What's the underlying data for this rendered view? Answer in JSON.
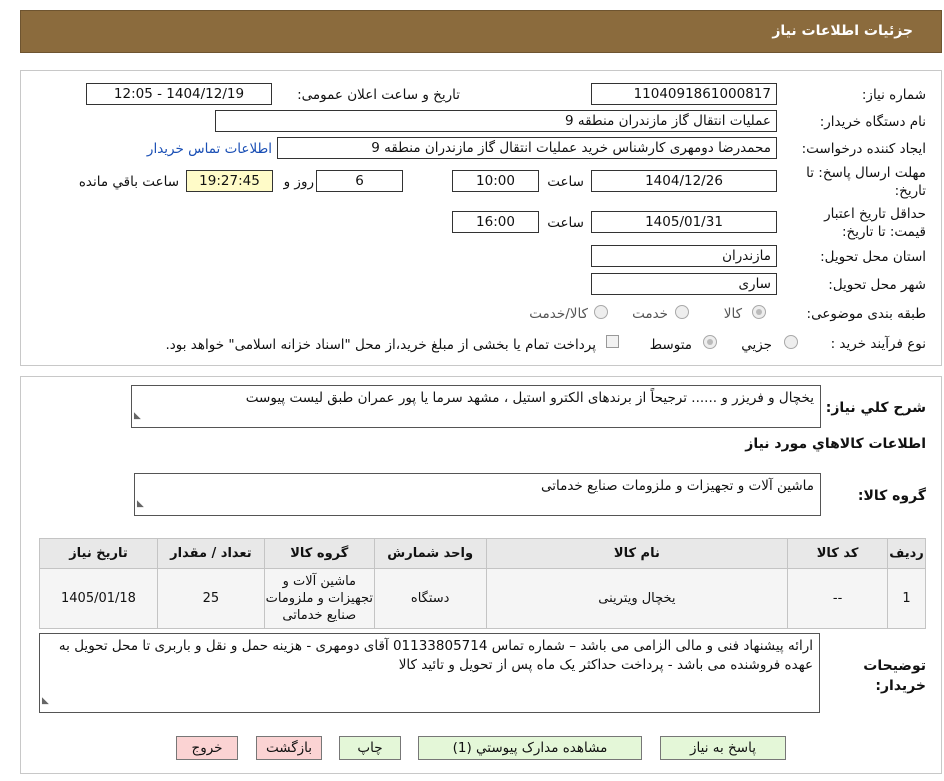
{
  "header": {
    "title": "جزئیات اطلاعات نیاز"
  },
  "form": {
    "need_number_label": "شماره نیاز:",
    "need_number": "1104091861000817",
    "announce_label": "تاریخ و ساعت اعلان عمومی:",
    "announce_value": "1404/12/19 - 12:05",
    "buyer_org_label": "نام دستگاه خریدار:",
    "buyer_org": "عملیات انتقال گاز مازندران منطقه 9",
    "requester_label": "ایجاد کننده درخواست:",
    "requester": "محمدرضا دومهری کارشناس خرید عملیات انتقال گاز مازندران منطقه 9",
    "contact_link": "اطلاعات تماس خریدار",
    "deadline_label": "مهلت ارسال پاسخ: تا تاریخ:",
    "deadline_date": "1404/12/26",
    "time_label": "ساعت",
    "deadline_time": "10:00",
    "days_value": "6",
    "days_label": "روز و",
    "remaining_time": "19:27:45",
    "remaining_label": "ساعت باقي مانده",
    "validity_label": "حداقل تاریخ اعتبار قیمت: تا تاریخ:",
    "validity_date": "1405/01/31",
    "validity_time": "16:00",
    "province_label": "استان محل تحویل:",
    "province": "مازندران",
    "city_label": "شهر محل تحویل:",
    "city": "ساری",
    "category_label": "طبقه بندی موضوعی:",
    "category_options": [
      "کالا",
      "خدمت",
      "کالا/خدمت"
    ],
    "process_label": "نوع فرآیند خرید :",
    "process_options": [
      "جزیي",
      "متوسط"
    ],
    "payment_note": "پرداخت تمام یا بخشی از مبلغ خرید،از محل \"اسناد خزانه اسلامی\" خواهد بود."
  },
  "description": {
    "label": "شرح كلي نياز:",
    "text": "یخچال و فریزر و ...... ترجیحاً از برندهای الکترو استیل ، مشهد سرما یا پور عمران طبق لیست پیوست"
  },
  "goods": {
    "section_title": "اطلاعات كالاهاي مورد نياز",
    "group_label": "گروه کالا:",
    "group_value": "ماشین آلات و تجهیزات و ملزومات صنایع خدماتی",
    "columns": [
      "رديف",
      "کد کالا",
      "نام کالا",
      "واحد شمارش",
      "گروه کالا",
      "تعداد / مقدار",
      "تاريخ نياز"
    ],
    "rows": [
      [
        "1",
        "--",
        "یخچال ویترینی",
        "دستگاه",
        "ماشین آلات و تجهیزات و ملزومات صنایع خدماتی",
        "25",
        "1405/01/18"
      ]
    ]
  },
  "buyer_notes": {
    "label": "توضيحات خريدار:",
    "text": "ارائه پیشنهاد فنی  و مالی الزامی می باشد – شماره تماس 01133805714 آقای دومهری  - هزینه حمل و نقل و باربری تا محل تحویل به عهده فروشنده می باشد - پرداخت حداکثر یک ماه پس از تحویل و تائید کالا"
  },
  "buttons": {
    "reply": "پاسخ به نياز",
    "attachments": "مشاهده مدارک پيوستي (1)",
    "print": "چاپ",
    "back": "بازگشت",
    "exit": "خروج"
  },
  "watermark": {
    "text": "AriaTender.neT"
  },
  "colors": {
    "header_bg": "#8b6b3d",
    "link": "#1a4fb5",
    "green_button": "#e4f7d8",
    "pink_button": "#fbd3d3",
    "remaining_bg": "#fffbc8"
  }
}
